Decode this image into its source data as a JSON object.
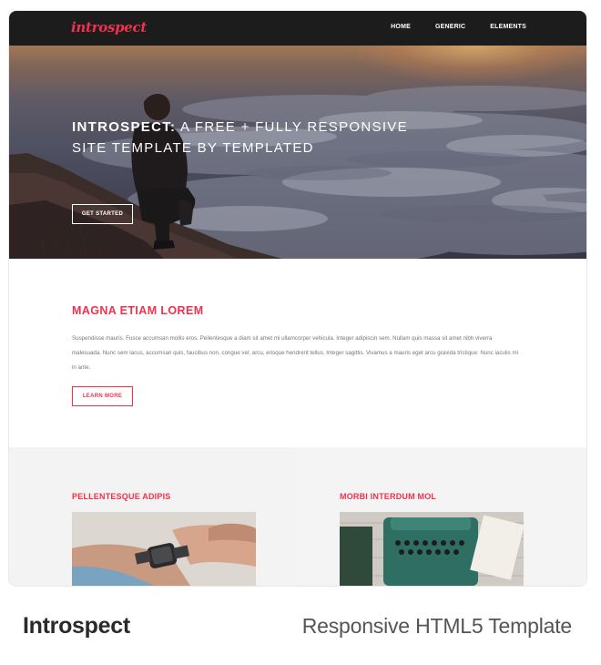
{
  "site": {
    "logo_text": "introspect",
    "brand_color": "#f2314c",
    "nav": [
      {
        "label": "HOME"
      },
      {
        "label": "GENERIC"
      },
      {
        "label": "ELEMENTS"
      }
    ]
  },
  "hero": {
    "title_line1_bold": "INTROSPECT:",
    "title_line1_rest": " A FREE + FULLY RESPONSIVE",
    "title_line2": "SITE TEMPLATE BY TEMPLATED",
    "button_label": "GET STARTED"
  },
  "intro": {
    "heading": "MAGNA ETIAM LOREM",
    "body": "Suspendisse mauris. Fusce accumsan mollis eros. Pellentesque a diam sit amet mi ullamcorper vehicula. Integer adipiscin sem. Nullam quis massa sit amet nibh viverra malesuada. Nunc sem lacus, accumsan quis, faucibus non, congue vel, arcu, erisque hendrerit tellus. Integer sagittis. Vivamus a mauris eget arcu gravida tristique. Nunc iaculis mi in ante.",
    "button_label": "LEARN MORE"
  },
  "columns": [
    {
      "heading": "PELLENTESQUE ADIPIS",
      "image_icon": "smartwatch-photo-icon"
    },
    {
      "heading": "MORBI INTERDUM MOL",
      "image_icon": "typewriter-photo-icon"
    }
  ],
  "caption": {
    "title": "Introspect",
    "subtitle": "Responsive HTML5 Template"
  }
}
